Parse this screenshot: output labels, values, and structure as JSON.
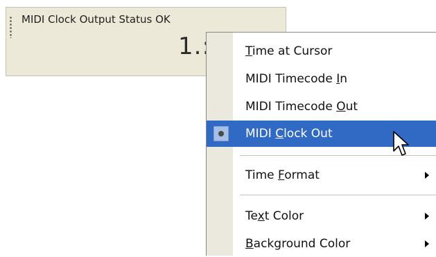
{
  "panel": {
    "status_text": "MIDI Clock Output Status OK",
    "readout_text": "1.:"
  },
  "context_menu": {
    "items": [
      {
        "label": "Time at Cursor",
        "mnemonic_index": 0
      },
      {
        "label": "MIDI Timecode In",
        "mnemonic_index": 14
      },
      {
        "label": "MIDI Timecode Out",
        "mnemonic_index": 14
      },
      {
        "label": "MIDI Clock Out",
        "mnemonic_index": 5,
        "selected": true,
        "checked": true
      },
      {
        "label": "Time Format",
        "mnemonic_index": 5,
        "submenu": true
      },
      {
        "label": "Text Color",
        "mnemonic_index": 2,
        "submenu": true
      },
      {
        "label": "Background Color",
        "mnemonic_index": 0,
        "submenu": true
      }
    ]
  },
  "colors": {
    "panel_bg": "#ece9d8",
    "menu_gutter": "#ebe8dd",
    "selection": "#316ac5",
    "checkmark_bg": "#a6bfe8"
  },
  "icons": {
    "grip": "grip-dots-icon",
    "check": "radio-dot-icon",
    "submenu": "triangle-right-icon",
    "cursor": "arrow-cursor-icon"
  }
}
